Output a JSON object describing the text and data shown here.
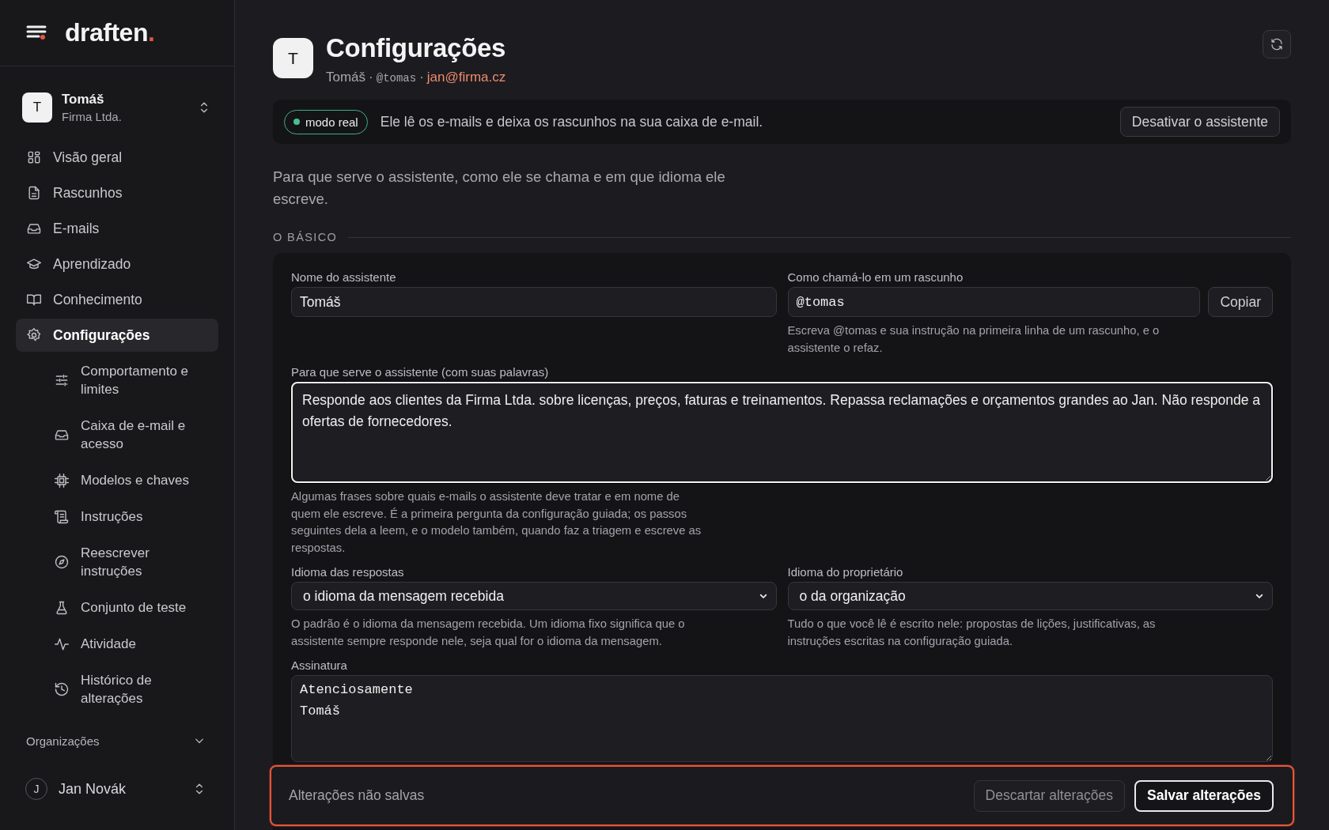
{
  "brand": {
    "name": "draften",
    "mark": "."
  },
  "workspace": {
    "avatar": "T",
    "name": "Tomáš",
    "org": "Firma Ltda."
  },
  "nav": [
    {
      "label": "Visão geral",
      "selected": false
    },
    {
      "label": "Rascunhos",
      "selected": false
    },
    {
      "label": "E-mails",
      "selected": false
    },
    {
      "label": "Aprendizado",
      "selected": false
    },
    {
      "label": "Conhecimento",
      "selected": false
    },
    {
      "label": "Configurações",
      "selected": true,
      "children": [
        {
          "label": "Comportamento e limites",
          "selected": false
        },
        {
          "label": "Caixa de e-mail e acesso",
          "selected": false
        },
        {
          "label": "Modelos e chaves",
          "selected": false
        },
        {
          "label": "Instruções",
          "selected": false
        },
        {
          "label": "Reescrever instruções",
          "selected": false
        },
        {
          "label": "Conjunto de teste",
          "selected": false
        },
        {
          "label": "Atividade",
          "selected": false
        },
        {
          "label": "Histórico de alterações",
          "selected": false
        }
      ]
    }
  ],
  "organizations": {
    "label": "Organizações",
    "expanded": false
  },
  "user": {
    "avatar": "J",
    "name": "Jan Novák"
  },
  "header": {
    "avatar": "T",
    "title": "Configurações",
    "name": "Tomáš",
    "separator": "·",
    "handle": "@tomas",
    "separator_2": "·",
    "email": "jan@firma.cz"
  },
  "mode_banner": {
    "badge": "modo real",
    "text": "Ele lê os e-mails e deixa os rascunhos na sua caixa de e-mail.",
    "button": "Desativar o assistente"
  },
  "intro": "Para que serve o assistente, como ele se chama e em que idioma ele escreve.",
  "section": "O BÁSICO",
  "fields": [
    {
      "kind": "text",
      "label": "Nome do assistente",
      "value": "Tomáš",
      "focused": false
    },
    {
      "kind": "handle",
      "label": "Como chamá-lo em um rascunho",
      "value": "@tomas",
      "button": "Copiar",
      "hint": "Escreva @tomas e sua instrução na primeira linha de um rascunho, e o assistente o refaz.",
      "focused": false
    },
    {
      "kind": "textarea",
      "label": "Para que serve o assistente (com suas palavras)",
      "value": "Responde aos clientes da Firma Ltda. sobre licenças, preços, faturas e treinamentos. Repassa reclamações e orçamentos grandes ao Jan. Não responde a ofertas de fornecedores.",
      "hint": "Algumas frases sobre quais e-mails o assistente deve tratar e em nome de quem ele escreve. É a primeira pergunta da configuração guiada; os passos seguintes dela a leem, e o modelo também, quando faz a triagem e escreve as respostas.",
      "focused": true
    },
    {
      "kind": "select",
      "label": "Idioma das respostas",
      "value": "o idioma da mensagem recebida",
      "hint": "O padrão é o idioma da mensagem recebida. Um idioma fixo significa que o assistente sempre responde nele, seja qual for o idioma da mensagem.",
      "focused": false
    },
    {
      "kind": "select",
      "label": "Idioma do proprietário",
      "value": "o da organização",
      "hint": "Tudo o que você lê é escrito nele: propostas de lições, justificativas, as instruções escritas na configuração guiada.",
      "focused": false
    },
    {
      "kind": "signature",
      "label": "Assinatura",
      "value": "Atenciosamente\nTomáš",
      "focused": false
    }
  ],
  "save_bar": {
    "text": "Alterações não salvas",
    "buttons": [
      {
        "label": "Descartar alterações",
        "kind": "secondary"
      },
      {
        "label": "Salvar alterações",
        "kind": "primary"
      }
    ]
  }
}
